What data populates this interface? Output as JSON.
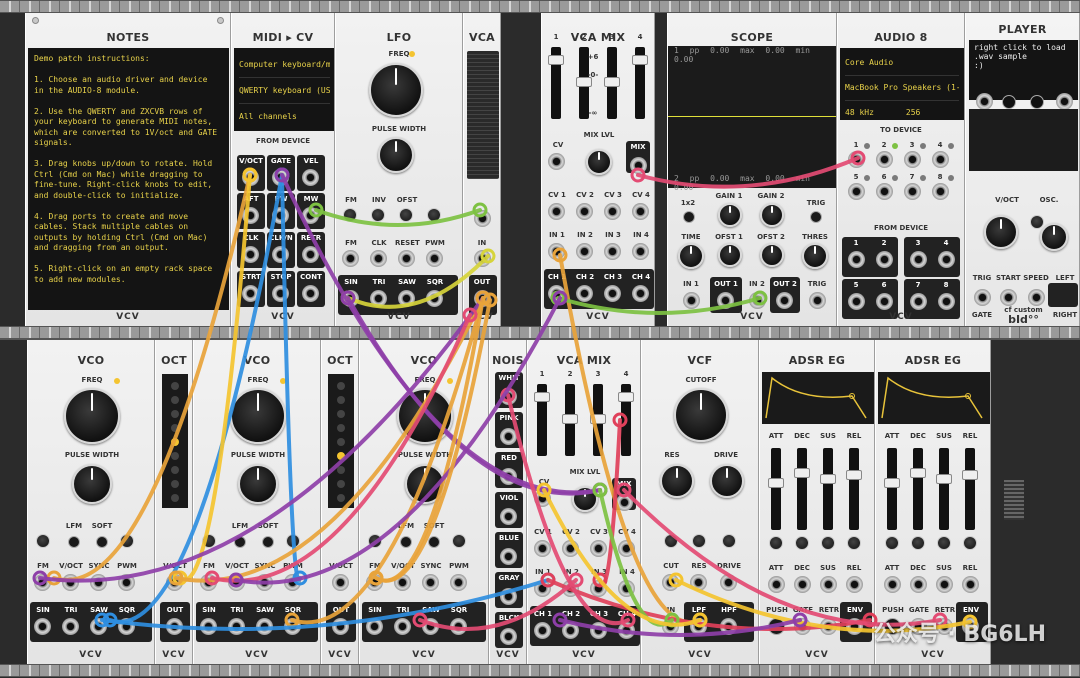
{
  "notes": {
    "title": "NOTES",
    "text": "Demo patch instructions:\n\n1. Choose an audio driver and device\nin the AUDIO-8 module.\n\n2. Use the QWERTY and ZXCVB rows of\nyour keyboard to generate MIDI notes,\nwhich are converted to 1V/oct and GATE\nsignals.\n\n3. Drag knobs up/down to rotate. Hold\nCtrl (Cmd on Mac) while dragging to\nfine-tune. Right-click knobs to edit,\nand double-click to initialize.\n\n4. Drag ports to create and move\ncables. Stack multiple cables on\noutputs by holding Ctrl (Cmd on Mac)\nand dragging from an output.\n\n5. Right-click on an empty rack space\nto add new modules."
  },
  "midi": {
    "title": "MIDI ▸ CV",
    "driver": "Computer keyboard/m",
    "device": "QWERTY keyboard (US",
    "channel": "All channels",
    "section": "FROM DEVICE",
    "ports": [
      "V/OCT",
      "GATE",
      "VEL",
      "AFT",
      "PW",
      "MW",
      "CLK",
      "CLK/N",
      "RETR",
      "STRT",
      "STOP",
      "CONT"
    ]
  },
  "lfo": {
    "title": "LFO",
    "freq": "FREQ",
    "pw": "PULSE WIDTH",
    "row1": [
      "FM",
      "INV",
      "OFST",
      ""
    ],
    "row2": [
      "FM",
      "CLK",
      "RESET",
      "PWM"
    ],
    "out": [
      "SIN",
      "TRI",
      "SAW",
      "SQR"
    ]
  },
  "vca": {
    "title": "VCA",
    "in": "IN",
    "out": "OUT"
  },
  "vcamix1": {
    "title": "VCA MIX",
    "chans": [
      "1",
      "2",
      "3",
      "4"
    ],
    "mixlvl": "MIX LVL",
    "cv": "CV",
    "mix": "MIX",
    "cvs": [
      "CV 1",
      "CV 2",
      "CV 3",
      "CV 4"
    ],
    "ins": [
      "IN 1",
      "IN 2",
      "IN 3",
      "IN 4"
    ],
    "outs": [
      "CH 1",
      "CH 2",
      "CH 3",
      "CH 4"
    ],
    "scale": [
      "+6",
      "-0-",
      "-∞"
    ]
  },
  "scope": {
    "title": "SCOPE",
    "top": [
      "1 pp",
      "0.00",
      "max",
      "0.00",
      "min",
      "0.00"
    ],
    "bot": [
      "2 pp",
      "0.00",
      "max",
      "0.00",
      "min",
      "0.00"
    ],
    "labels": [
      "1x2",
      "GAIN 1",
      "GAIN 2",
      "TRIG",
      "TIME",
      "OFST 1",
      "OFST 2",
      "THRES",
      "IN 1",
      "OUT 1",
      "IN 2",
      "OUT 2",
      "TRIG"
    ]
  },
  "audio": {
    "title": "AUDIO 8",
    "driver": "Core Audio",
    "device": "MacBook Pro Speakers (1-",
    "rate": "48 kHz",
    "block": "256",
    "to": "TO DEVICE",
    "from": "FROM DEVICE",
    "nums": [
      "1",
      "2",
      "3",
      "4",
      "5",
      "6",
      "7",
      "8"
    ]
  },
  "player": {
    "title": "PLAYER",
    "msg": "right click to load\n.wav sample\n:)",
    "labels": [
      "V/OCT",
      "OSC.",
      "TRIG",
      "START",
      "SPEED",
      "LEFT",
      "GATE",
      "RIGHT"
    ],
    "brand": "cf custom",
    "logo": "bId°°"
  },
  "vco1": {
    "title": "VCO",
    "freq": "FREQ",
    "pw": "PULSE WIDTH",
    "mid": [
      "LFM",
      "SOFT"
    ],
    "ins": [
      "FM",
      "V/OCT",
      "SYNC",
      "PWM"
    ],
    "outs": [
      "SIN",
      "TRI",
      "SAW",
      "SQR"
    ]
  },
  "oct1": {
    "title": "OCT",
    "out": "OUT",
    "vo": "V/OCT"
  },
  "vco2": {
    "title": "VCO",
    "freq": "FREQ",
    "pw": "PULSE WIDTH",
    "mid": [
      "LFM",
      "SOFT"
    ],
    "ins": [
      "FM",
      "V/OCT",
      "SYNC",
      "PWM"
    ],
    "outs": [
      "SIN",
      "TRI",
      "SAW",
      "SQR"
    ]
  },
  "oct2": {
    "title": "OCT",
    "out": "OUT",
    "vo": "V/OCT"
  },
  "vco3": {
    "title": "VCO",
    "freq": "FREQ",
    "pw": "PULSE WIDTH",
    "mid": [
      "LFM",
      "SOFT"
    ],
    "ins": [
      "FM",
      "V/OCT",
      "SYNC",
      "PWM"
    ],
    "outs": [
      "SIN",
      "TRI",
      "SAW",
      "SQR"
    ]
  },
  "nois": {
    "title": "NOIS",
    "items": [
      "WHIT",
      "PINK",
      "RED",
      "VIOL",
      "BLUE",
      "GRAY",
      "BLCK"
    ]
  },
  "vcamix2": {
    "title": "VCA MIX",
    "chans": [
      "1",
      "2",
      "3",
      "4"
    ],
    "mixlvl": "MIX LVL",
    "cv": "CV",
    "mix": "MIX",
    "cvs": [
      "CV 1",
      "CV 2",
      "CV 3",
      "CV 4"
    ],
    "ins": [
      "IN 1",
      "IN 2",
      "IN 3",
      "IN 4"
    ],
    "outs": [
      "CH 1",
      "CH 2",
      "CH 3",
      "CH 4"
    ]
  },
  "vcf": {
    "title": "VCF",
    "cutoff": "CUTOFF",
    "res": "RES",
    "drive": "DRIVE",
    "ins": [
      "CUT",
      "RES",
      "DRIVE"
    ],
    "outs": [
      "IN",
      "LPF",
      "HPF"
    ]
  },
  "adsr1": {
    "title": "ADSR EG",
    "sl": [
      "ATT",
      "DEC",
      "SUS",
      "REL"
    ],
    "cv": [
      "ATT",
      "DEC",
      "SUS",
      "REL"
    ],
    "io": [
      "PUSH",
      "GATE",
      "RETR",
      "ENV"
    ]
  },
  "adsr2": {
    "title": "ADSR EG",
    "sl": [
      "ATT",
      "DEC",
      "SUS",
      "REL"
    ],
    "cv": [
      "ATT",
      "DEC",
      "SUS",
      "REL"
    ],
    "io": [
      "PUSH",
      "GATE",
      "RETR",
      "ENV"
    ]
  },
  "brand": "VCV",
  "watermark": "公众号 · BG6LH",
  "colors": {
    "yellow": "#f4c430",
    "orange": "#e8a33a",
    "purple": "#8e3fa8",
    "green": "#7dc142",
    "red": "#e0405a",
    "pink": "#e34b73",
    "blue": "#2f8ee0",
    "yellowLime": "#d6d43b"
  }
}
